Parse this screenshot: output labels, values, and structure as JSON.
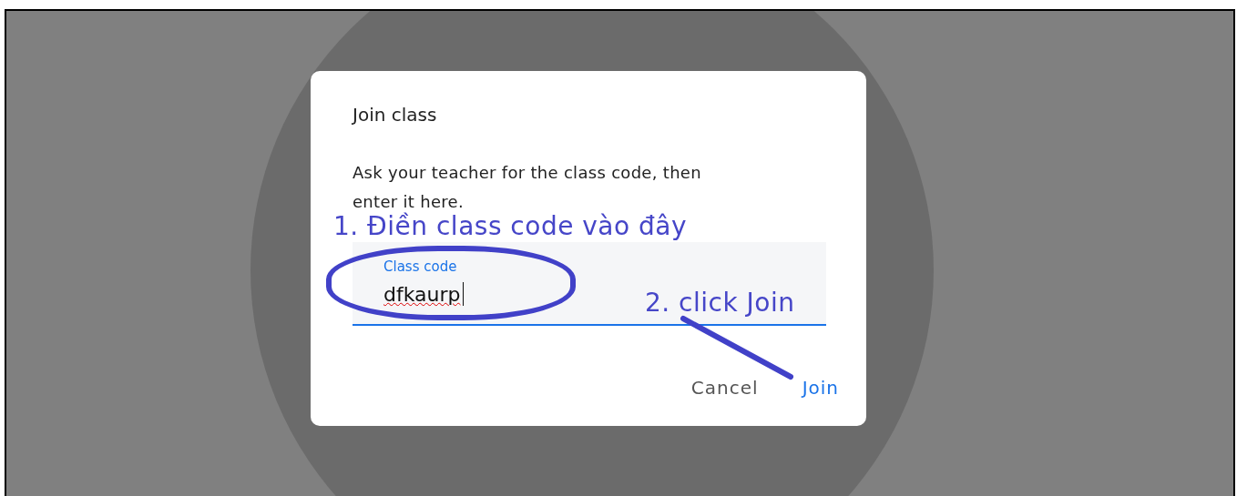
{
  "dialog": {
    "title": "Join class",
    "message": "Ask your teacher for the class code, then enter it here.",
    "field": {
      "label": "Class code",
      "value": "dfkaurp",
      "focused": true
    },
    "buttons": [
      {
        "label": "Cancel",
        "kind": "secondary"
      },
      {
        "label": "Join",
        "kind": "primary"
      }
    ]
  },
  "annotations": [
    {
      "kind": "step",
      "text": "1. Điền class code vào đây"
    },
    {
      "kind": "step",
      "text": "2. click Join"
    }
  ]
}
